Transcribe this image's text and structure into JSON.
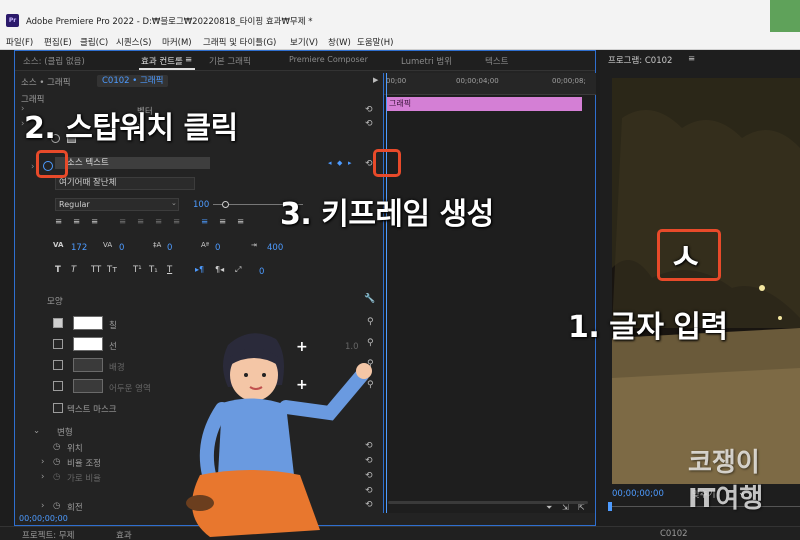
{
  "window": {
    "app_icon": "Pr",
    "title": "Adobe Premiere Pro 2022 - D:₩블로그₩20220818_타이핑 효과₩무제 *"
  },
  "menu": [
    "파일(F)",
    "편집(E)",
    "클립(C)",
    "시퀀스(S)",
    "마커(M)",
    "그래픽 및 타이틀(G)",
    "보기(V)",
    "창(W)",
    "도움말(H)"
  ],
  "tabs": {
    "source": "소스: (클립 없음)",
    "effect_controls": "효과 컨트롤",
    "essential_graphics": "기본 그래픽",
    "composer": "Premiere Composer",
    "lumetri": "Lumetri 범위",
    "text": "텍스트"
  },
  "effect_controls": {
    "source_label": "소스 • 그래픽",
    "clip_label": "C0102 • 그래픽",
    "group_graphic": "그래픽",
    "vector_label": "벡터",
    "shape_label": "스",
    "source_text_label": "소스 텍스트",
    "text_value": "여기어때 잘난체",
    "font_style": "Regular",
    "font_size": "100",
    "tracking": "172",
    "kerning": "0",
    "leading": "0",
    "baseline": "0",
    "tsume": "400",
    "tab_value": "0",
    "appearance_label": "모양",
    "fill_label": "칠",
    "stroke_label": "선",
    "stroke_value": "1.0",
    "background_label": "배경",
    "shadow_label": "어두운 영역",
    "text_mask_label": "텍스트 마스크",
    "transform_label": "변형",
    "position_label": "위치",
    "scale_label": "비율 조정",
    "scale_width_label": "가로 비율",
    "rotation_label": "회전",
    "timecode": "00;00;00;00"
  },
  "timeline": {
    "ruler": [
      "00;00",
      "00;00;04;00",
      "00;00;08;"
    ],
    "clip_label": "그래픽"
  },
  "program": {
    "title": "프로그램: C0102",
    "timecode": "00;00;00;00",
    "fit": "맞추기",
    "overlay_glyph": "ㅅ"
  },
  "bottom": {
    "project": "프로젝트: 무제",
    "effects": "효과",
    "seq": "C0102"
  },
  "annotations": {
    "step2": "2. 스탑워치 클릭",
    "step3": "3. 키프레임 생성",
    "step1": "1. 글자 입력"
  },
  "watermark": {
    "line1": "코쟁이",
    "line2": "IT여행"
  },
  "colors": {
    "accent_blue": "#4d9bff",
    "clip_pink": "#d47fd5",
    "annotation_red": "#e84a2a",
    "panel_focus": "#2f6fcf"
  }
}
